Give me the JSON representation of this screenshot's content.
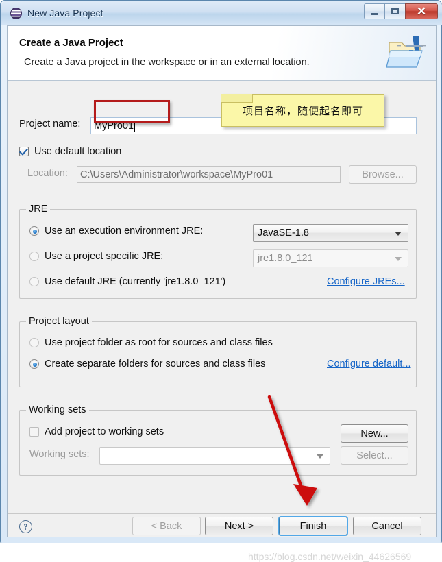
{
  "window": {
    "title": "New Java Project",
    "icon": "eclipse-globe-icon",
    "caption_buttons": {
      "minimize": "minimize-icon",
      "maximize": "maximize-icon",
      "close": "✕"
    }
  },
  "banner": {
    "title": "Create a Java Project",
    "subtitle": "Create a Java project in the workspace or in an external location.",
    "icon": "java-project-folder-icon"
  },
  "form": {
    "project_name_label": "Project name:",
    "project_name_value": "MyPro01",
    "use_default_location_label": "Use default location",
    "use_default_location_checked": true,
    "location_label": "Location:",
    "location_value": "C:\\Users\\Administrator\\workspace\\MyPro01",
    "browse_label": "Browse...",
    "browse_enabled": false
  },
  "jre": {
    "group_title": "JRE",
    "options": [
      {
        "label": "Use an execution environment JRE:",
        "selected": true,
        "combo_value": "JavaSE-1.8",
        "combo_enabled": true
      },
      {
        "label": "Use a project specific JRE:",
        "selected": false,
        "combo_value": "jre1.8.0_121",
        "combo_enabled": false
      },
      {
        "label": "Use default JRE (currently 'jre1.8.0_121')",
        "selected": false
      }
    ],
    "configure_link": "Configure JREs..."
  },
  "project_layout": {
    "group_title": "Project layout",
    "options": [
      {
        "label": "Use project folder as root for sources and class files",
        "selected": false
      },
      {
        "label": "Create separate folders for sources and class files",
        "selected": true
      }
    ],
    "configure_link": "Configure default..."
  },
  "working_sets": {
    "group_title": "Working sets",
    "add_label": "Add project to working sets",
    "add_checked": false,
    "sets_label": "Working sets:",
    "sets_value": "",
    "new_label": "New...",
    "select_label": "Select...",
    "select_enabled": false
  },
  "buttons": {
    "help": "?",
    "back": "< Back",
    "back_enabled": false,
    "next": "Next >",
    "finish": "Finish",
    "cancel": "Cancel"
  },
  "annotations": {
    "note_text": "项目名称，随便起名即可",
    "highlight_color": "#b41b1b",
    "arrow_color": "#cc1111",
    "note_bg": "#fbf7a8"
  },
  "watermark": "https://blog.csdn.net/weixin_44626569"
}
